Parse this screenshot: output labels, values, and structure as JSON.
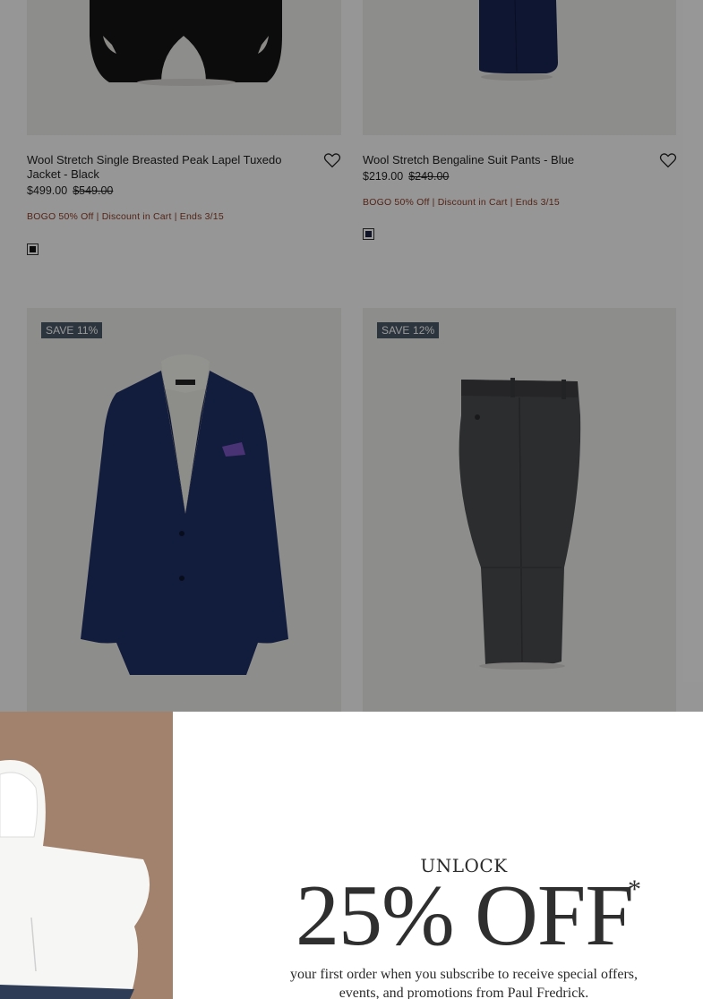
{
  "products": [
    {
      "title": "Wool Stretch Single Breasted Peak Lapel Tuxedo Jacket - Black",
      "price": "$499.00",
      "original_price": "$549.00",
      "promo": "BOGO 50% Off | Discount in Cart | Ends 3/15",
      "swatch_color": "#111111",
      "icon": "heart-icon"
    },
    {
      "title": "Wool Stretch Bengaline Suit Pants - Blue",
      "price": "$219.00",
      "original_price": "$249.00",
      "promo": "BOGO 50% Off | Discount in Cart | Ends 3/15",
      "swatch_color": "#1a2340",
      "icon": "heart-icon"
    },
    {
      "badge": "SAVE 11%",
      "product_color": "#1f3064"
    },
    {
      "badge": "SAVE 12%",
      "product_color": "#4a4b4e"
    }
  ],
  "modal": {
    "eyebrow": "UNLOCK",
    "headline": "25% OFF",
    "asterisk": "*",
    "subtext": "your first order when you subscribe to receive special offers, events, and promotions from Paul Fredrick."
  },
  "colors": {
    "promo_text": "#8a3b26",
    "badge_bg": "#4a5966",
    "modal_image_bg": "#a2826c",
    "overlay": "rgba(0,0,0,0.40)"
  }
}
